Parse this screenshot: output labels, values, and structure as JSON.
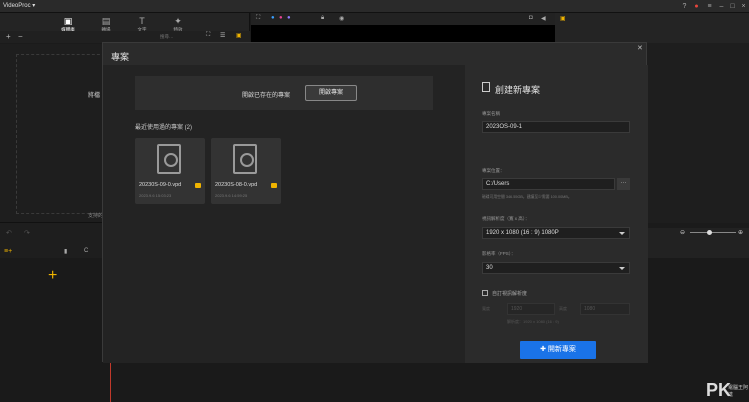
{
  "titlebar": {
    "app_name": "VideoProc ▾"
  },
  "left_tabs": [
    {
      "label": "媒體庫",
      "icon": "media-icon"
    },
    {
      "label": "轉場",
      "icon": "transition-icon"
    },
    {
      "label": "文字",
      "icon": "text-icon"
    },
    {
      "label": "特效",
      "icon": "effects-icon"
    }
  ],
  "library": {
    "search_placeholder": "搜尋…"
  },
  "media": {
    "hint": "將檔",
    "hint2": "支持的"
  },
  "dialog": {
    "title": "專案",
    "open_existing_label": "開啟已存在的專案",
    "open_button": "開啟專案",
    "recent_title": "最近使用過的專案 (2)",
    "recent": [
      {
        "name": "20230S-09-0.vpd",
        "date": "2023.9.6 15:03:23"
      },
      {
        "name": "20230S-08-0.vpd",
        "date": "2023.9.6 14:59:25"
      }
    ],
    "new_title": "創建新專案",
    "name_label": "專案名稱",
    "name_value": "2023OS-09-1",
    "location_label": "專案位置：",
    "location_value": "C:/Users",
    "location_info": "磁碟可用空間 346.55GB，建議至少需要 100.00MB。",
    "resolution_label": "視訊解析度（寬 x 高）：",
    "resolution_value": "1920 x 1080  (16 : 9)  1080P",
    "fps_label": "影格率（FPS）：",
    "fps_value": "30",
    "custom_label": "自訂視訊解析度",
    "custom_w_label": "寬度",
    "custom_w": "1920",
    "custom_h_label": "高度",
    "custom_h": "1080",
    "custom_ratio": "解析度：1920 x 1080 (16 : 9)",
    "create_button": "✚ 開新專案"
  },
  "watermark": {
    "logo": "PK",
    "sub": "電腦王阿達"
  }
}
